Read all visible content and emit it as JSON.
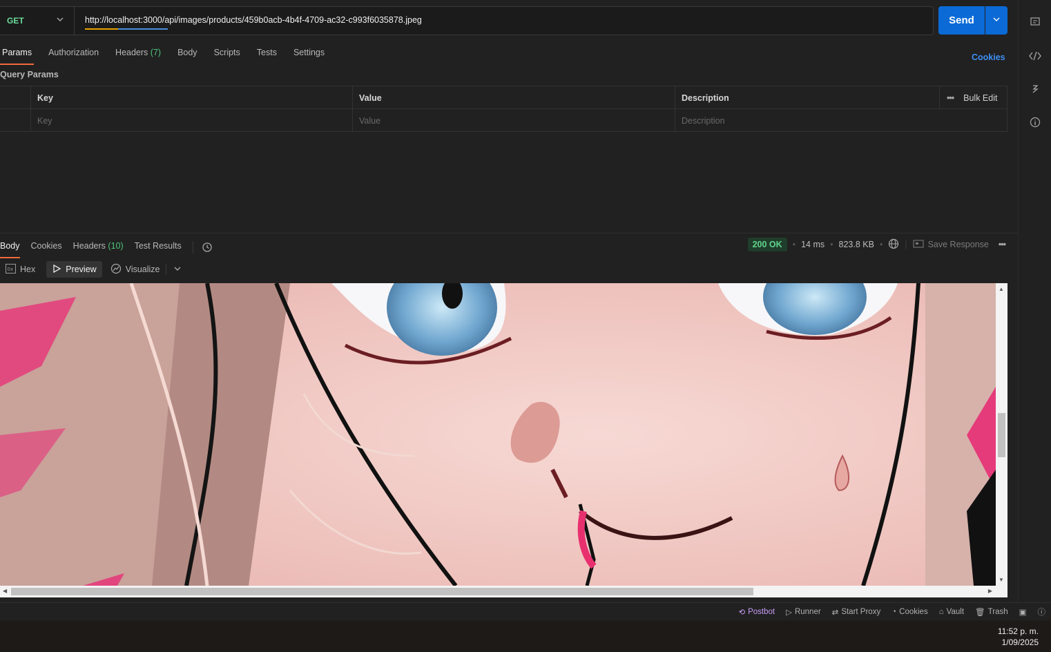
{
  "request": {
    "method": "GET",
    "url": "http://localhost:3000/api/images/products/459b0acb-4b4f-4709-ac32-c993f6035878.jpeg",
    "send_label": "Send"
  },
  "request_tabs": {
    "params": "Params",
    "authorization": "Authorization",
    "headers": "Headers",
    "headers_count": "(7)",
    "body": "Body",
    "scripts": "Scripts",
    "tests": "Tests",
    "settings": "Settings",
    "cookies": "Cookies"
  },
  "query_params": {
    "title": "Query Params",
    "columns": {
      "key": "Key",
      "value": "Value",
      "description": "Description"
    },
    "placeholders": {
      "key": "Key",
      "value": "Value",
      "description": "Description"
    },
    "bulk_edit": "Bulk Edit"
  },
  "response_tabs": {
    "body": "Body",
    "cookies": "Cookies",
    "headers": "Headers",
    "headers_count": "(10)",
    "test_results": "Test Results"
  },
  "response_meta": {
    "status": "200 OK",
    "time": "14 ms",
    "size": "823.8 KB",
    "save_response": "Save Response"
  },
  "view_modes": {
    "hex": "Hex",
    "preview": "Preview",
    "visualize": "Visualize"
  },
  "statusbar": {
    "postbot": "Postbot",
    "runner": "Runner",
    "start_proxy": "Start Proxy",
    "cookies": "Cookies",
    "vault": "Vault",
    "trash": "Trash"
  },
  "taskbar": {
    "time": "11:52 p. m.",
    "date": "1/09/2025"
  },
  "colors": {
    "send": "#0b6ad6",
    "method": "#6bdd9a",
    "active_tab": "#f26b3a",
    "status_ok": "#62d48d",
    "link": "#3d8ff2"
  }
}
